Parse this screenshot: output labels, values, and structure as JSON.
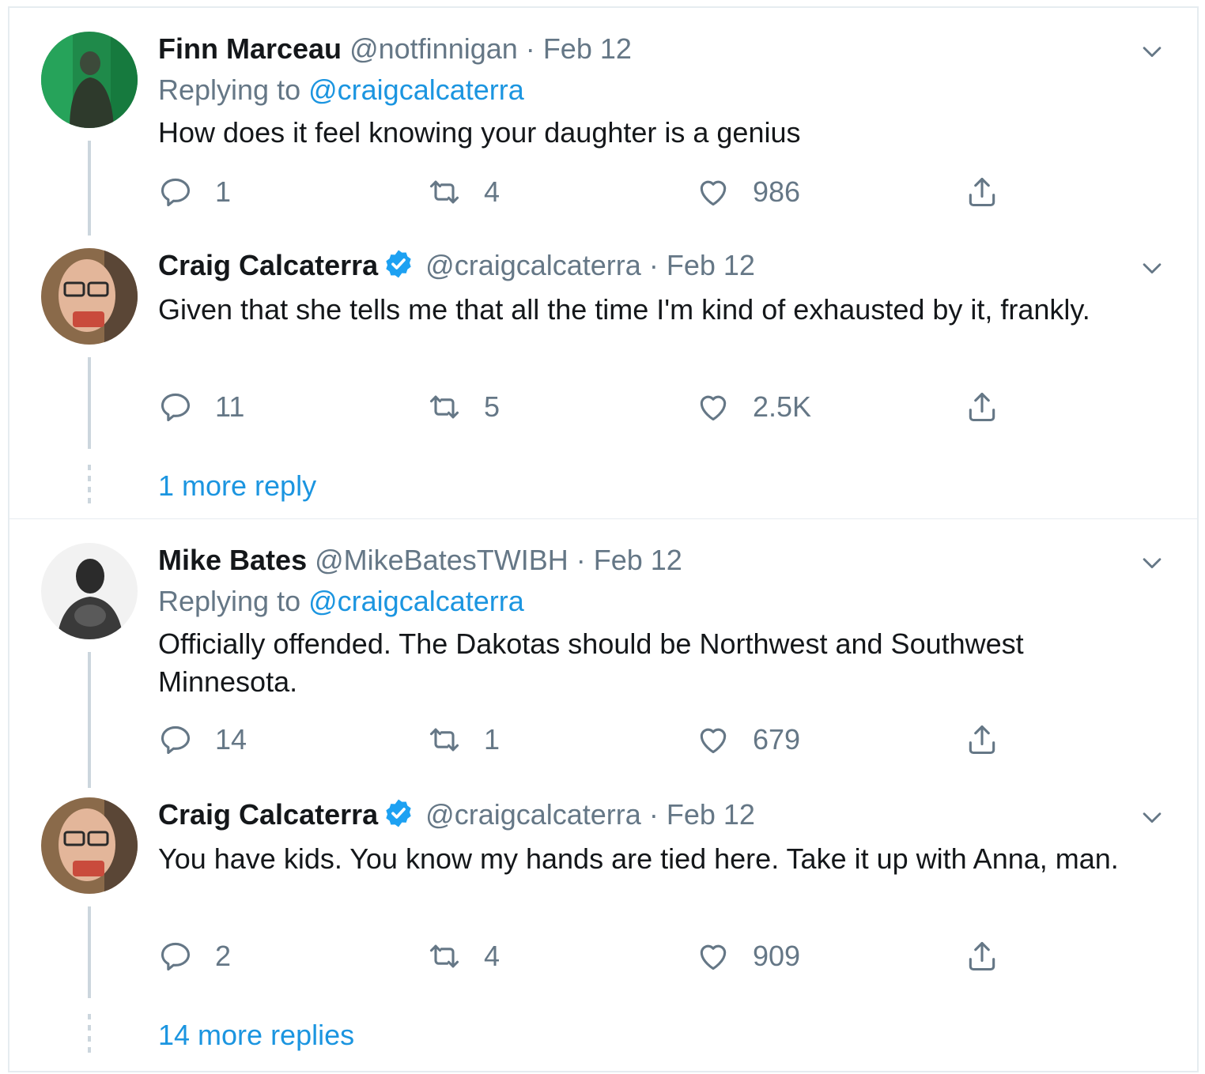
{
  "threads": [
    {
      "tweets": [
        {
          "name": "Finn Marceau",
          "handle": "@notfinnigan",
          "date": "Feb 12",
          "replying_prefix": "Replying to",
          "replying_to": "@craigcalcaterra",
          "text": "How does it feel knowing your daughter is a genius",
          "replies": "1",
          "retweets": "4",
          "likes": "986"
        },
        {
          "name": "Craig Calcaterra",
          "verified": true,
          "handle": "@craigcalcaterra",
          "date": "Feb 12",
          "text": "Given that she tells me that all the time I'm kind of exhausted by it, frankly.",
          "replies": "11",
          "retweets": "5",
          "likes": "2.5K"
        }
      ],
      "more_replies": "1 more reply"
    },
    {
      "tweets": [
        {
          "name": "Mike Bates",
          "handle": "@MikeBatesTWIBH",
          "date": "Feb 12",
          "replying_prefix": "Replying to",
          "replying_to": "@craigcalcaterra",
          "text": "Officially offended. The Dakotas should be Northwest and Southwest Minnesota.",
          "replies": "14",
          "retweets": "1",
          "likes": "679"
        },
        {
          "name": "Craig Calcaterra",
          "verified": true,
          "handle": "@craigcalcaterra",
          "date": "Feb 12",
          "text": "You have kids. You know my hands are tied here. Take it up with Anna, man.",
          "replies": "2",
          "retweets": "4",
          "likes": "909"
        }
      ],
      "more_replies": "14 more replies"
    }
  ],
  "separator": "·",
  "colors": {
    "link": "#1b95e0",
    "muted": "#657786",
    "verified": "#1da1f2",
    "border": "#e6ecf0"
  }
}
